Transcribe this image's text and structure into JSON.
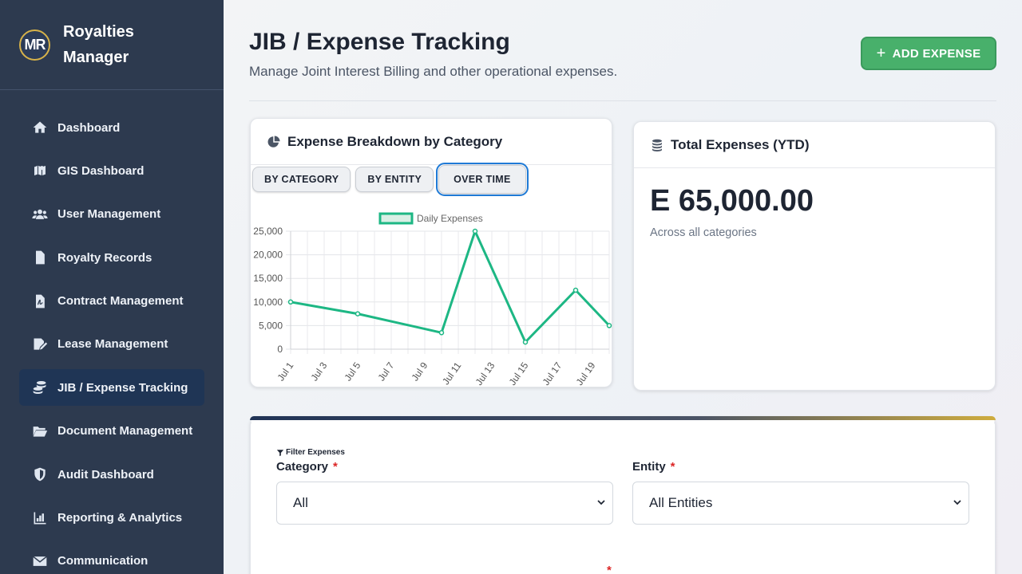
{
  "brand": {
    "initials": "MR",
    "name": "Royalties Manager"
  },
  "sidebar": {
    "items": [
      {
        "label": "Dashboard",
        "icon": "home-icon"
      },
      {
        "label": "GIS Dashboard",
        "icon": "map-icon"
      },
      {
        "label": "User Management",
        "icon": "users-icon"
      },
      {
        "label": "Royalty Records",
        "icon": "document-icon"
      },
      {
        "label": "Contract Management",
        "icon": "contract-icon"
      },
      {
        "label": "Lease Management",
        "icon": "signature-icon"
      },
      {
        "label": "JIB / Expense Tracking",
        "icon": "coins-icon",
        "active": true
      },
      {
        "label": "Document Management",
        "icon": "folder-icon"
      },
      {
        "label": "Audit Dashboard",
        "icon": "shield-icon"
      },
      {
        "label": "Reporting & Analytics",
        "icon": "bar-chart-icon"
      },
      {
        "label": "Communication",
        "icon": "envelope-icon"
      }
    ]
  },
  "header": {
    "title": "JIB / Expense Tracking",
    "subtitle": "Manage Joint Interest Billing and other operational expenses.",
    "add_button": "ADD EXPENSE"
  },
  "breakdown": {
    "title": "Expense Breakdown by Category",
    "tabs": [
      "BY CATEGORY",
      "BY ENTITY",
      "OVER TIME"
    ],
    "active_tab": "OVER TIME"
  },
  "chart_data": {
    "type": "line",
    "series": [
      {
        "name": "Daily Expenses",
        "color": "#1db784",
        "points": [
          {
            "x": "Jul 1",
            "y": 10000
          },
          {
            "x": "Jul 5",
            "y": 7500
          },
          {
            "x": "Jul 10",
            "y": 3500
          },
          {
            "x": "Jul 12",
            "y": 25000
          },
          {
            "x": "Jul 15",
            "y": 1500
          },
          {
            "x": "Jul 18",
            "y": 12500
          },
          {
            "x": "Jul 20",
            "y": 5000
          }
        ]
      }
    ],
    "x_ticks": [
      "Jul 1",
      "Jul 3",
      "Jul 5",
      "Jul 7",
      "Jul 9",
      "Jul 11",
      "Jul 13",
      "Jul 15",
      "Jul 17",
      "Jul 19"
    ],
    "y_ticks": [
      "0",
      "5,000",
      "10,000",
      "15,000",
      "20,000",
      "25,000"
    ],
    "ylim": [
      0,
      25000
    ],
    "legend": "top",
    "grid": true
  },
  "total": {
    "title": "Total Expenses (YTD)",
    "value": "E 65,000.00",
    "subtitle": "Across all categories"
  },
  "filters": {
    "title": "Filter Expenses",
    "category_label": "Category",
    "category_value": "All",
    "entity_label": "Entity",
    "entity_value": "All Entities",
    "required_mark": "*"
  }
}
